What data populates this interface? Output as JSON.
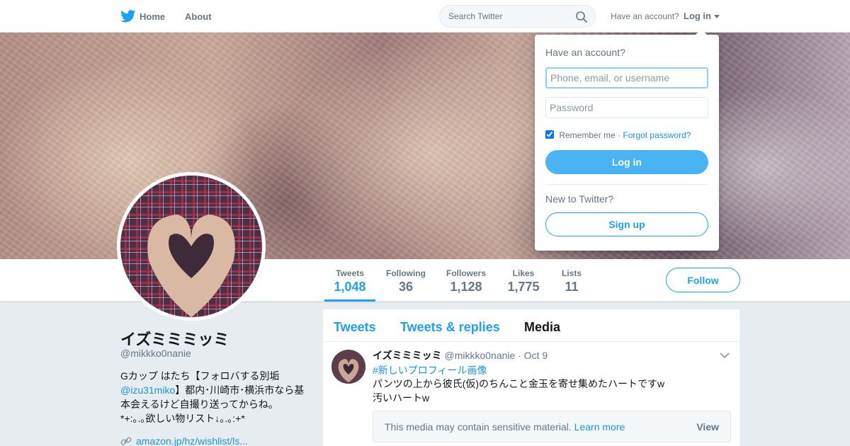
{
  "colors": {
    "accent": "#1da1f2",
    "link": "#1b95e0",
    "login_button": "#4ab3f4",
    "page_bg": "#e6ecf0"
  },
  "nav": {
    "logo_icon": "twitter-bird-icon",
    "home_label": "Home",
    "about_label": "About",
    "search_placeholder": "Search Twitter",
    "search_icon": "search-icon",
    "have_account": "Have an account?",
    "login_label": "Log in"
  },
  "stats": [
    {
      "label": "Tweets",
      "value": "1,048",
      "active": true
    },
    {
      "label": "Following",
      "value": "36"
    },
    {
      "label": "Followers",
      "value": "1,128"
    },
    {
      "label": "Likes",
      "value": "1,775"
    },
    {
      "label": "Lists",
      "value": "11"
    }
  ],
  "follow_label": "Follow",
  "profile": {
    "name": "イズミミミッミ",
    "handle": "@mikkko0nanie",
    "bio_part1": "Gカップ はたち【フォロバする別垢",
    "bio_mention": "@izu31miko",
    "bio_part2": "】都内･川崎市･横浜市なら基本会えるけど自撮り送ってからね。",
    "bio_line3": "*+:｡.｡欲しい物リスト↓｡.｡:+*",
    "url": "amazon.jp/hz/wishlist/ls...",
    "url_icon": "link-icon"
  },
  "timeline": {
    "tabs": [
      "Tweets",
      "Tweets & replies",
      "Media"
    ],
    "current_tab": "Media",
    "tweet": {
      "author": "イズミミミッミ",
      "handle": "@mikkko0nanie",
      "separator": "·",
      "date": "Oct 9",
      "hashtag": "#新しいプロフィール画像",
      "line1": "パンツの上から彼氏(仮)のちんこと金玉を寄せ集めたハートですw",
      "line2": "汚いハートw",
      "sensitive_text": "This media may contain sensitive material.",
      "learn_more": "Learn more",
      "view_label": "View"
    }
  },
  "login_dropdown": {
    "heading": "Have an account?",
    "username_placeholder": "Phone, email, or username",
    "password_placeholder": "Password",
    "remember_label": "Remember me",
    "separator": "·",
    "forgot_label": "Forgot password?",
    "login_button": "Log in",
    "new_to": "New to Twitter?",
    "signup_button": "Sign up"
  }
}
